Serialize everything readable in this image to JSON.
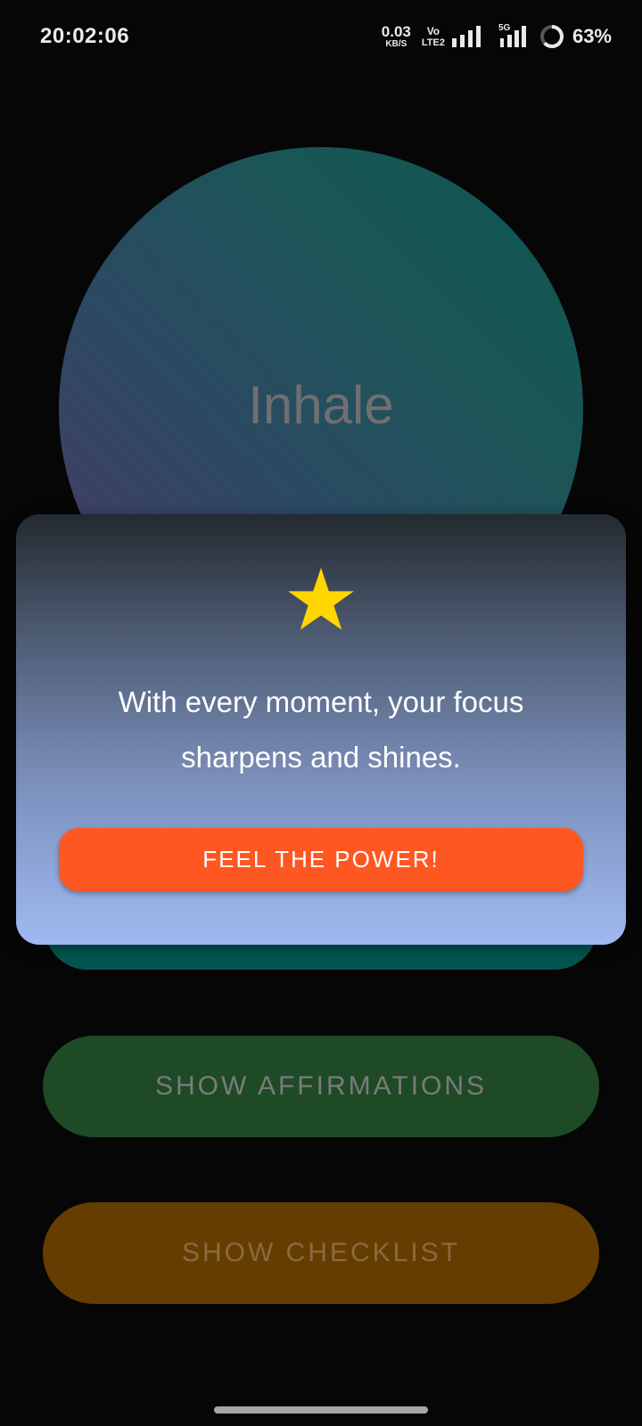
{
  "status_bar": {
    "time": "20:02:06",
    "net_speed_value": "0.03",
    "net_speed_unit": "KB/S",
    "volte_top": "Vo",
    "volte_bottom": "LTE2",
    "network_label": "5G",
    "battery_percent": "63%"
  },
  "breath": {
    "label": "Inhale"
  },
  "modal": {
    "icon": "star-icon",
    "message_line1": "With every moment, your focus",
    "message_line2": "sharpens and shines.",
    "button_label": "FEEL THE POWER!"
  },
  "buttons": {
    "affirmations": "SHOW AFFIRMATIONS",
    "checklist": "SHOW CHECKLIST"
  },
  "colors": {
    "accent_button": "#ff5722",
    "star": "#ffd600",
    "affirmations_bg": "#1e4a26",
    "checklist_bg": "#653d00"
  }
}
